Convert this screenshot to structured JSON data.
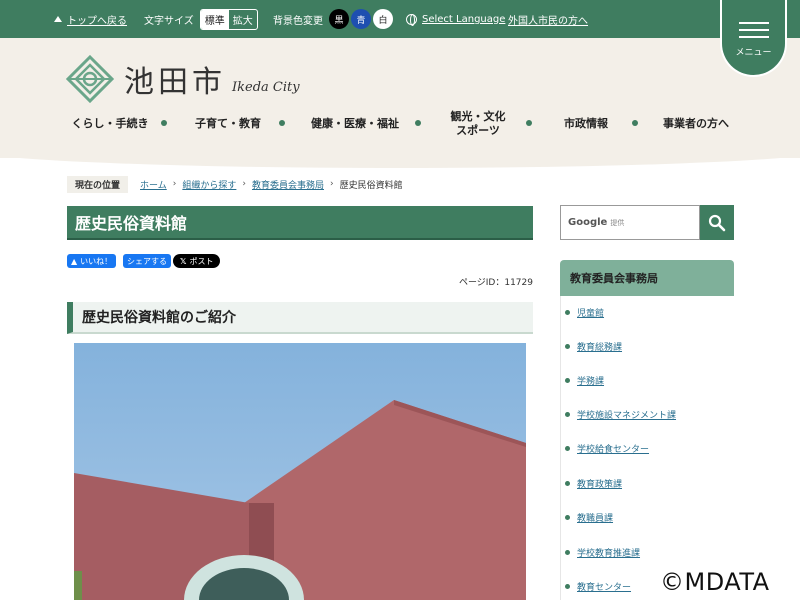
{
  "topbar": {
    "to_top": "トップへ戻る",
    "text_size_label": "文字サイズ",
    "size_standard": "標準",
    "size_large": "拡大",
    "bg_color_label": "背景色変更",
    "bg_black": "黒",
    "bg_blue": "青",
    "bg_white": "白",
    "select_language": "Select Language",
    "foreign_residents": "外国人市民の方へ"
  },
  "menu": {
    "label": "メニュー"
  },
  "logo": {
    "name": "池田市",
    "english": "Ikeda City"
  },
  "gnav": [
    {
      "label": "くらし・手続き"
    },
    {
      "label": "子育て・教育"
    },
    {
      "label": "健康・医療・福祉"
    },
    {
      "label_line1": "観光・文化",
      "label_line2": "スポーツ"
    },
    {
      "label": "市政情報"
    },
    {
      "label": "事業者の方へ"
    }
  ],
  "breadcrumb": {
    "current_label": "現在の位置",
    "items": [
      "ホーム",
      "組織から探す",
      "教育委員会事務局"
    ],
    "current": "歴史民俗資料館"
  },
  "page": {
    "title": "歴史民俗資料館",
    "like": "いいね！",
    "share": "シェアする",
    "post": "ポスト",
    "page_id": "ページID：11729",
    "section_title": "歴史民俗資料館のご紹介"
  },
  "search": {
    "brand": "Google",
    "sub": "提供"
  },
  "sidebar": {
    "title": "教育委員会事務局",
    "items": [
      "児童館",
      "教育総務課",
      "学務課",
      "学校施設マネジメント課",
      "学校給食センター",
      "教育政策課",
      "教職員課",
      "学校教育推進課",
      "教育センター"
    ]
  },
  "watermark": "©MDATA",
  "colors": {
    "primary": "#3f7d60",
    "header_bg": "#f3efe8",
    "side_head": "#7fb09a",
    "link": "#2a6f8f"
  }
}
